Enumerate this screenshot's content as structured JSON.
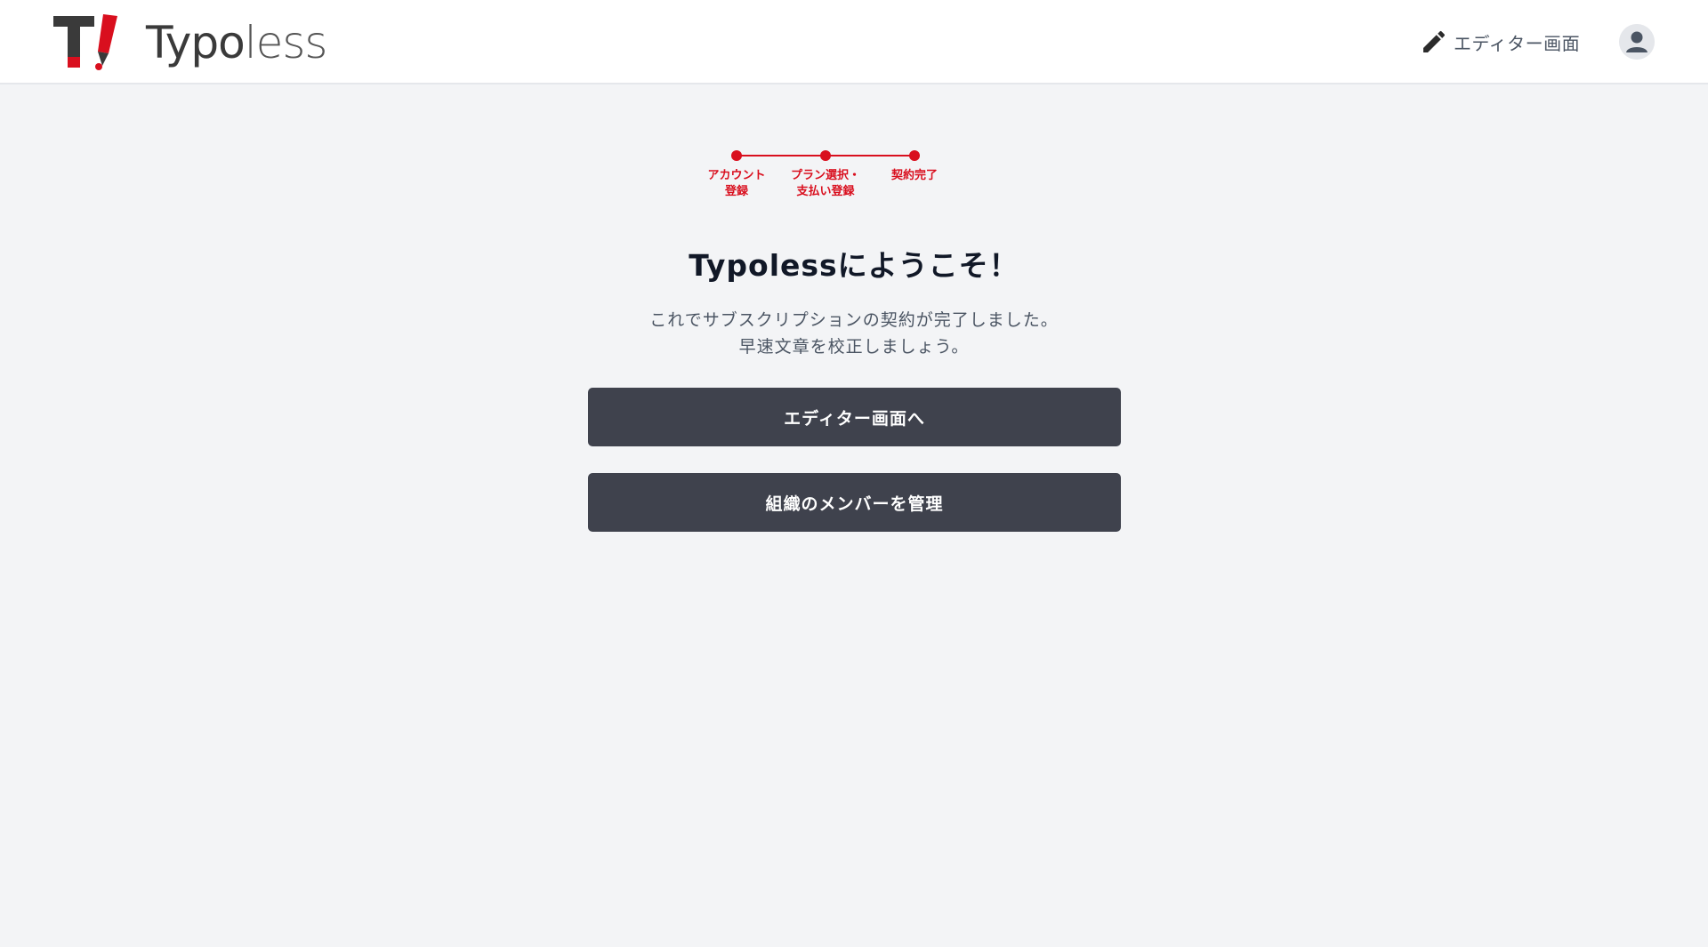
{
  "header": {
    "logo_word_bold": "Typo",
    "logo_word_light": "less",
    "editor_link_label": "エディター画面",
    "editor_icon": "pencil-icon",
    "avatar_icon": "user-icon"
  },
  "stepper": {
    "steps": [
      {
        "label": "アカウント\n登録",
        "status": "complete"
      },
      {
        "label": "プラン選択・\n支払い登録",
        "status": "complete"
      },
      {
        "label": "契約完了",
        "status": "complete"
      }
    ]
  },
  "main": {
    "title": "Typolessにようこそ！",
    "message_line1": "これでサブスクリプションの契約が完了しました。",
    "message_line2": "早速文章を校正しましょう。",
    "editor_button_label": "エディター画面へ",
    "members_button_label": "組織のメンバーを管理"
  },
  "colors": {
    "accent": "#d90f1e",
    "button": "#3f424d",
    "background": "#f3f4f6"
  }
}
